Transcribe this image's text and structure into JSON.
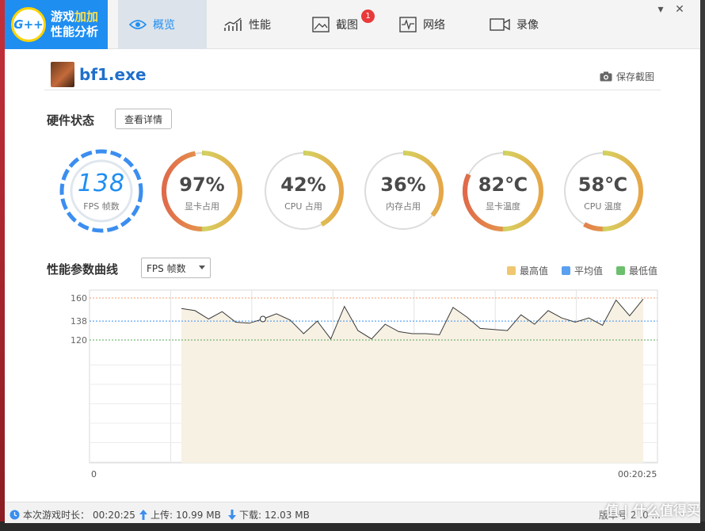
{
  "app": {
    "logo_badge": "G++",
    "logo_line1": "游戏",
    "logo_line1_accent": "加加",
    "logo_line2": "性能分析"
  },
  "tabs": [
    {
      "label": "概览",
      "icon": "eye-icon",
      "active": true
    },
    {
      "label": "性能",
      "icon": "trend-chart-icon"
    },
    {
      "label": "截图",
      "icon": "picture-icon",
      "badge": "1"
    },
    {
      "label": "网络",
      "icon": "pulse-icon"
    },
    {
      "label": "录像",
      "icon": "video-icon"
    }
  ],
  "window": {
    "pin": "▾",
    "close": "✕"
  },
  "process": {
    "name": "bf1.exe",
    "save_label": "保存截图"
  },
  "hardware": {
    "title": "硬件状态",
    "detail_button": "查看详情",
    "gauges": [
      {
        "value": "138",
        "label": "FPS 帧数",
        "percent": 100
      },
      {
        "value": "97%",
        "label": "显卡占用",
        "percent": 97
      },
      {
        "value": "42%",
        "label": "CPU 占用",
        "percent": 42
      },
      {
        "value": "36%",
        "label": "内存占用",
        "percent": 36
      },
      {
        "value": "82℃",
        "label": "显卡温度",
        "percent": 82
      },
      {
        "value": "58℃",
        "label": "CPU 温度",
        "percent": 58
      }
    ]
  },
  "chart_header": {
    "title": "性能参数曲线",
    "select_value": "FPS 帧数",
    "legend": [
      {
        "label": "最高值",
        "color": "#f0c770"
      },
      {
        "label": "平均值",
        "color": "#5aa0f0"
      },
      {
        "label": "最低值",
        "color": "#6cbf6c"
      }
    ]
  },
  "chart_data": {
    "type": "line",
    "yticks": [
      "160",
      "138",
      "120"
    ],
    "x_start_label": "0",
    "x_end_label": "00:20:25",
    "max": 160,
    "avg": 138,
    "min": 120,
    "values": [
      150,
      148,
      140,
      147,
      137,
      136,
      140,
      145,
      139,
      126,
      138,
      121,
      152,
      129,
      121,
      135,
      128,
      126,
      126,
      125,
      151,
      142,
      131,
      130,
      129,
      144,
      135,
      148,
      141,
      137,
      141,
      134,
      158,
      143,
      159
    ]
  },
  "status": {
    "duration_label": "本次游戏时长：",
    "duration_value": "00:20:25",
    "upload_label": "上传:",
    "upload_value": "10.99 MB",
    "download_label": "下载:",
    "download_value": "12.03 MB",
    "version": "版本号 2 .0 ...",
    "watermark": "值 | 什么值得买"
  }
}
